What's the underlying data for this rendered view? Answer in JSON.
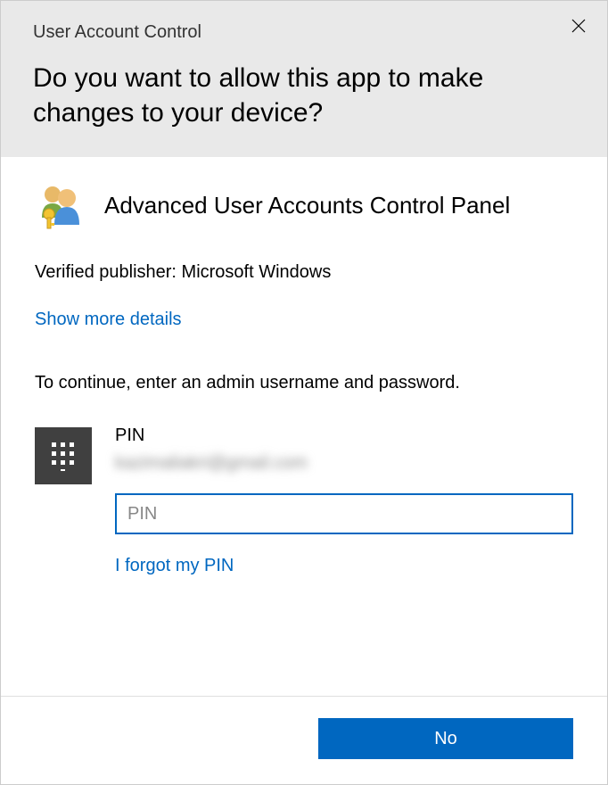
{
  "header": {
    "title": "User Account Control",
    "question": "Do you want to allow this app to make changes to your device?"
  },
  "app": {
    "name": "Advanced User Accounts Control Panel",
    "publisher": "Verified publisher: Microsoft Windows"
  },
  "links": {
    "show_more": "Show more details",
    "forgot_pin": "I forgot my PIN"
  },
  "cred": {
    "continue_text": "To continue, enter an admin username and password.",
    "pin_label": "PIN",
    "account_obscured": "kazimaliakri@gmail.com",
    "pin_placeholder": "PIN"
  },
  "footer": {
    "no": "No"
  }
}
